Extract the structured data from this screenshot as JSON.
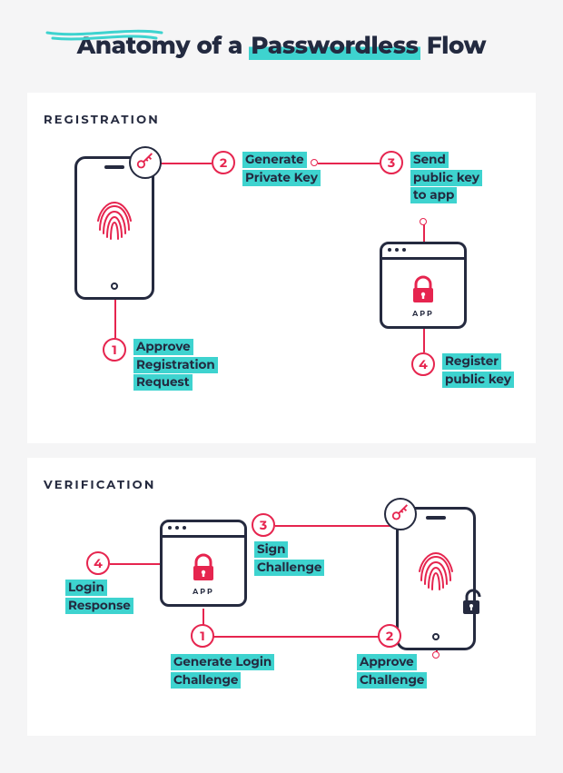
{
  "title": {
    "pre": "Anatomy of a ",
    "highlight": "Passwordless",
    "post": " Flow"
  },
  "registration": {
    "heading": "REGISTRATION",
    "app_label": "APP",
    "steps": [
      {
        "num": "1",
        "label": "Approve\nRegistration\nRequest"
      },
      {
        "num": "2",
        "label": "Generate\nPrivate Key"
      },
      {
        "num": "3",
        "label": "Send\npublic key\nto app"
      },
      {
        "num": "4",
        "label": "Register\npublic key"
      }
    ]
  },
  "verification": {
    "heading": "VERIFICATION",
    "app_label": "APP",
    "steps": [
      {
        "num": "1",
        "label": "Generate Login\nChallenge"
      },
      {
        "num": "2",
        "label": "Approve\nChallenge"
      },
      {
        "num": "3",
        "label": "Sign\nChallenge"
      },
      {
        "num": "4",
        "label": "Login\nResponse"
      }
    ]
  }
}
